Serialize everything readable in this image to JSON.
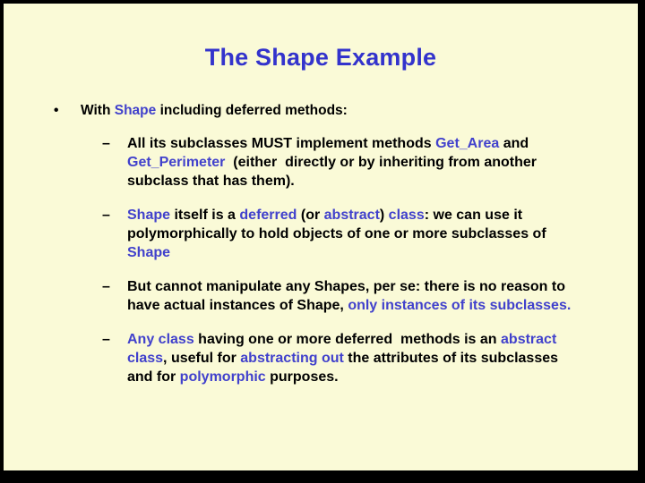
{
  "slide": {
    "title": "The Shape Example",
    "background_color": "#FAFAD7",
    "frame_color": "#000000",
    "title_color": "#3333CC",
    "highlight_color": "#4141CC",
    "text_color": "#000000",
    "bullet_marker_level1": "•",
    "bullet_marker_level2": "–",
    "bullets": [
      {
        "level": 1,
        "marker": "•",
        "plain_text": "With Shape including deferred methods:",
        "runs": [
          {
            "text": "With ",
            "color": "black"
          },
          {
            "text": "Shape",
            "color": "blue"
          },
          {
            "text": " including deferred methods:",
            "color": "black"
          }
        ]
      },
      {
        "level": 2,
        "marker": "–",
        "plain_text": "All its subclasses MUST implement methods Get_Area and Get_Perimeter  (either  directly or by inheriting from another subclass that has them).",
        "runs": [
          {
            "text": "All its subclasses MUST implement methods ",
            "color": "black"
          },
          {
            "text": "Get_Area",
            "color": "blue"
          },
          {
            "text": " and ",
            "color": "black"
          },
          {
            "text": "Get_Perimeter",
            "color": "blue"
          },
          {
            "text": "  (either  directly or by inheriting from another subclass that has them).",
            "color": "black"
          }
        ]
      },
      {
        "level": 2,
        "marker": "–",
        "plain_text": "Shape itself is a deferred (or abstract) class: we can use it polymorphically to hold objects of one or more subclasses of Shape",
        "runs": [
          {
            "text": "Shape",
            "color": "blue"
          },
          {
            "text": " itself is a ",
            "color": "black"
          },
          {
            "text": "deferred",
            "color": "blue"
          },
          {
            "text": " (or ",
            "color": "black"
          },
          {
            "text": "abstract",
            "color": "blue"
          },
          {
            "text": ") ",
            "color": "black"
          },
          {
            "text": "class",
            "color": "blue"
          },
          {
            "text": ": we can use it polymorphically to hold objects of one or more subclasses of ",
            "color": "black"
          },
          {
            "text": "Shape",
            "color": "blue"
          }
        ]
      },
      {
        "level": 2,
        "marker": "–",
        "plain_text": "But cannot manipulate any Shapes, per se: there is no reason to have actual instances of Shape, only instances of its subclasses.",
        "runs": [
          {
            "text": "But cannot manipulate any Shapes, per se: there is no reason to have actual instances of Shape, ",
            "color": "black"
          },
          {
            "text": "only instances of its subclasses.",
            "color": "blue"
          }
        ]
      },
      {
        "level": 2,
        "marker": "–",
        "plain_text": "Any class having one or more deferred  methods is an abstract class, useful for abstracting out the attributes of its subclasses and for polymorphic purposes.",
        "runs": [
          {
            "text": "Any class",
            "color": "blue"
          },
          {
            "text": " having one or more deferred  methods is an ",
            "color": "black"
          },
          {
            "text": "abstract class",
            "color": "blue"
          },
          {
            "text": ", useful for ",
            "color": "black"
          },
          {
            "text": "abstracting out",
            "color": "blue"
          },
          {
            "text": " the attributes of its subclasses and for ",
            "color": "black"
          },
          {
            "text": "polymorphic",
            "color": "blue"
          },
          {
            "text": " purposes.",
            "color": "black"
          }
        ]
      }
    ]
  }
}
